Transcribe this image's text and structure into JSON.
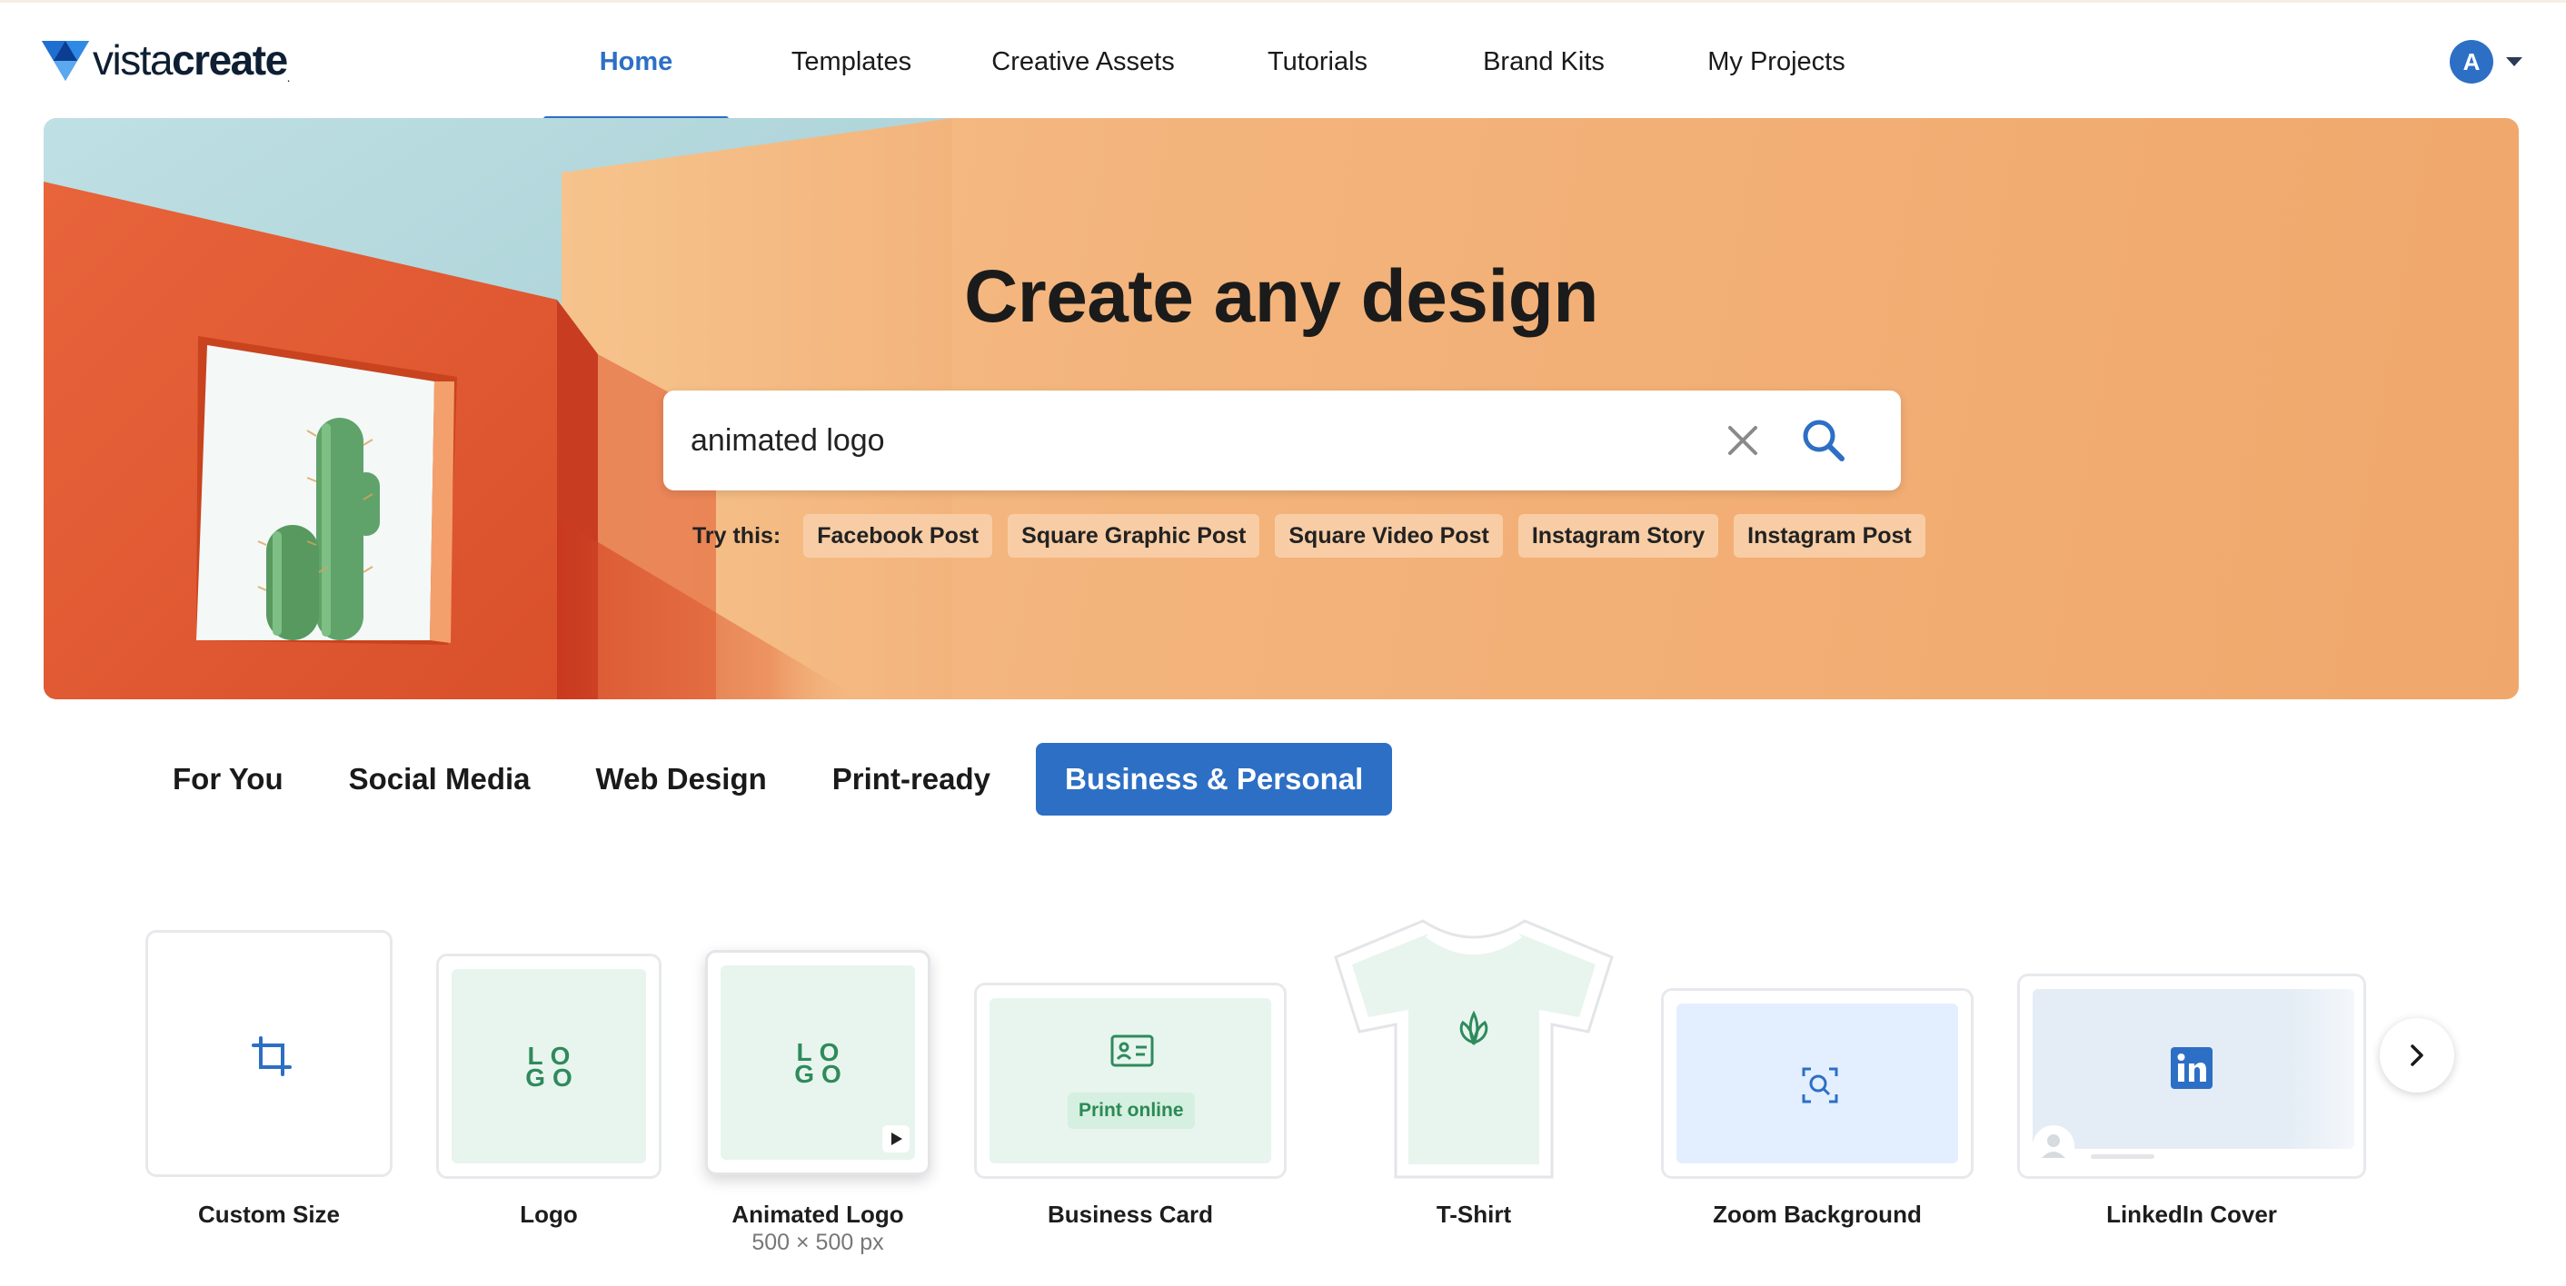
{
  "brand": {
    "name_light": "vista",
    "name_bold": "create"
  },
  "nav": {
    "items": [
      {
        "label": "Home",
        "active": true
      },
      {
        "label": "Templates",
        "active": false
      },
      {
        "label": "Creative Assets",
        "active": false
      },
      {
        "label": "Tutorials",
        "active": false
      },
      {
        "label": "Brand Kits",
        "active": false
      },
      {
        "label": "My Projects",
        "active": false
      }
    ]
  },
  "user": {
    "initial": "A"
  },
  "hero": {
    "title": "Create any design",
    "search_value": "animated logo",
    "try_label": "Try this:",
    "suggestions": [
      "Facebook Post",
      "Square Graphic Post",
      "Square Video Post",
      "Instagram Story",
      "Instagram Post"
    ]
  },
  "categories": [
    {
      "label": "For You",
      "active": false
    },
    {
      "label": "Social Media",
      "active": false
    },
    {
      "label": "Web Design",
      "active": false
    },
    {
      "label": "Print-ready",
      "active": false
    },
    {
      "label": "Business & Personal",
      "active": true
    }
  ],
  "formats": [
    {
      "label": "Custom Size",
      "icon": "crop-icon"
    },
    {
      "label": "Logo",
      "icon": "logo-icon"
    },
    {
      "label": "Animated Logo",
      "icon": "logo-icon",
      "sub": "500 × 500 px",
      "hovered": true
    },
    {
      "label": "Business Card",
      "icon": "id-card-icon",
      "badge": "Print online"
    },
    {
      "label": "T-Shirt",
      "icon": "leaf-icon"
    },
    {
      "label": "Zoom Background",
      "icon": "search-icon"
    },
    {
      "label": "LinkedIn Cover",
      "icon": "linkedin-icon"
    }
  ],
  "colors": {
    "accent": "#2d6fc4",
    "hero_bg": "#f3b47c",
    "chip_bg": "#f8cda5",
    "mint": "#e8f5ee",
    "logo_green": "#2f8a5c"
  }
}
